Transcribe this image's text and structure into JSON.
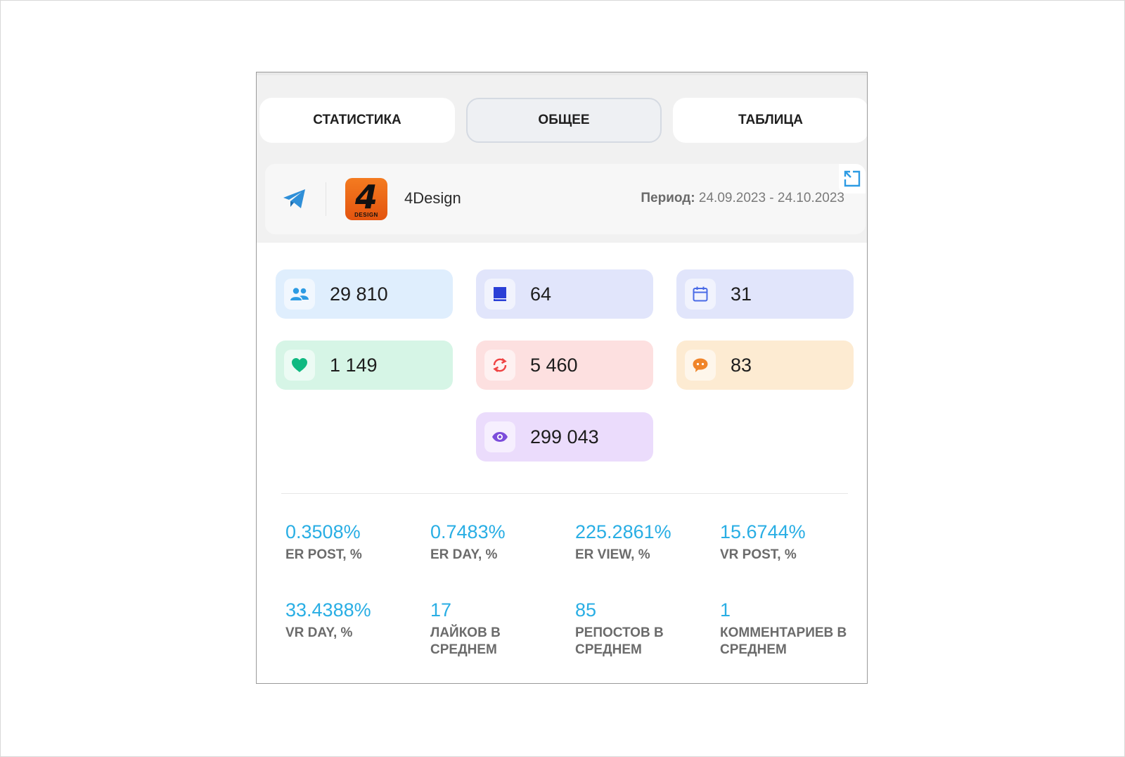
{
  "tabs": [
    {
      "label": "СТАТИСТИКА",
      "active": false
    },
    {
      "label": "ОБЩЕЕ",
      "active": true
    },
    {
      "label": "ТАБЛИЦА",
      "active": false
    }
  ],
  "channel": {
    "platform_icon": "telegram-icon",
    "avatar_text": "4",
    "avatar_subtext": "DESIGN",
    "name": "4Design",
    "period_label": "Период:",
    "period_value": "24.09.2023 - 24.10.2023"
  },
  "stats": [
    {
      "icon": "users-icon",
      "value": "29 810",
      "bg": "#dfeefd",
      "icon_color": "#2d9be3"
    },
    {
      "icon": "book-icon",
      "value": "64",
      "bg": "#e1e5fb",
      "icon_color": "#2a3fd6"
    },
    {
      "icon": "calendar-icon",
      "value": "31",
      "bg": "#e1e5fb",
      "icon_color": "#4a6be6"
    },
    {
      "icon": "heart-icon",
      "value": "1 149",
      "bg": "#d6f5e6",
      "icon_color": "#10b981"
    },
    {
      "icon": "repost-icon",
      "value": "5 460",
      "bg": "#fde0e0",
      "icon_color": "#ef4444"
    },
    {
      "icon": "comment-icon",
      "value": "83",
      "bg": "#fdebd2",
      "icon_color": "#f0852a"
    },
    {
      "icon": "eye-icon",
      "value": "299 043",
      "bg": "#ebdcfc",
      "icon_color": "#7c4ddb"
    }
  ],
  "metrics": [
    {
      "value": "0.3508%",
      "label": "ER POST, %"
    },
    {
      "value": "0.7483%",
      "label": "ER DAY, %"
    },
    {
      "value": "225.2861%",
      "label": "ER VIEW, %"
    },
    {
      "value": "15.6744%",
      "label": "VR POST, %"
    },
    {
      "value": "33.4388%",
      "label": "VR DAY, %"
    },
    {
      "value": "17",
      "label": "ЛАЙКОВ В СРЕДНЕМ"
    },
    {
      "value": "85",
      "label": "РЕПОСТОВ В СРЕДНЕМ"
    },
    {
      "value": "1",
      "label": "КОММЕНТАРИЕВ В СРЕДНЕМ"
    }
  ],
  "colors": {
    "accent": "#29aee4",
    "telegram": "#2f8fd8"
  }
}
